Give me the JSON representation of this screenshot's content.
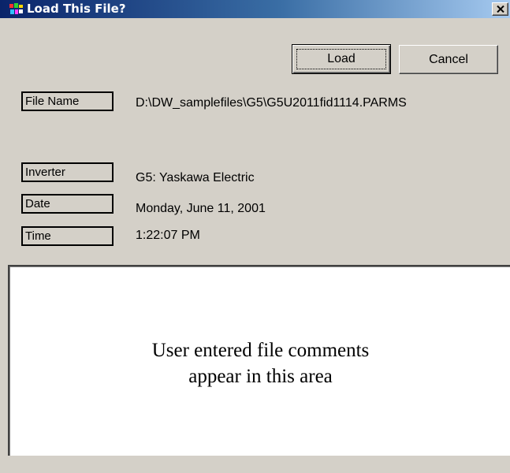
{
  "window": {
    "title": "Load This File?",
    "app_icon": "application-icon",
    "close_icon": "close-icon"
  },
  "buttons": {
    "load_label": "Load",
    "cancel_label": "Cancel"
  },
  "fields": [
    {
      "label": "File Name",
      "value": "D:\\DW_samplefiles\\G5\\G5U2011fid1114.PARMS"
    },
    {
      "label": "Inverter",
      "value": "G5: Yaskawa Electric"
    },
    {
      "label": "Date",
      "value": "Monday, June 11, 2001"
    },
    {
      "label": "Time",
      "value": "1:22:07 PM"
    }
  ],
  "comments": {
    "line1": "User entered file comments",
    "line2": "appear in this area"
  },
  "colors": {
    "titlebar_start": "#0a246a",
    "titlebar_end": "#a6caf0",
    "dialog_bg": "#d4d0c8"
  }
}
